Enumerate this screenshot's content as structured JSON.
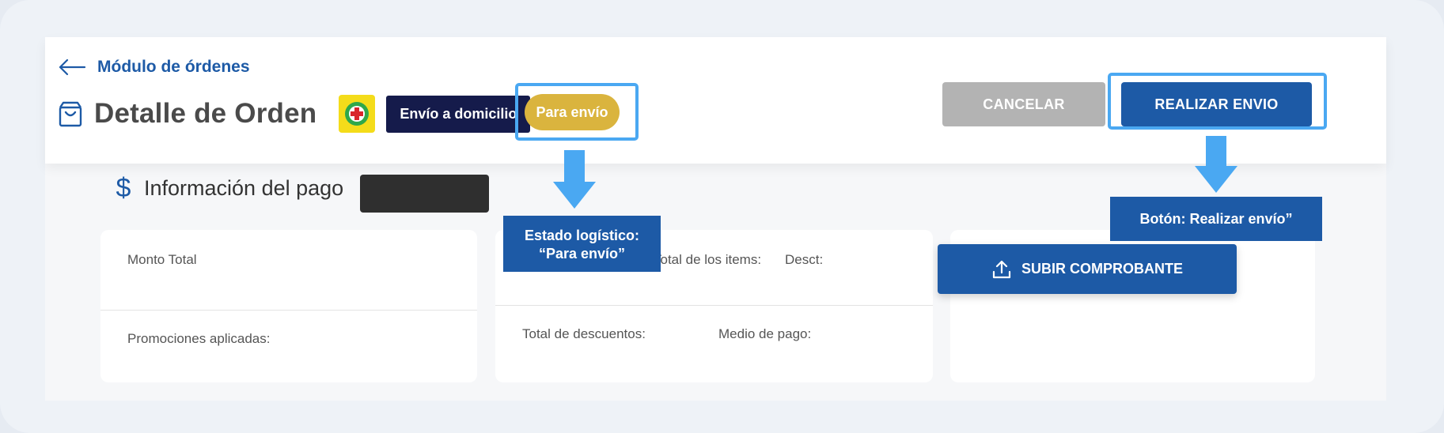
{
  "header": {
    "back_label": "Módulo de órdenes",
    "title": "Detalle de Orden",
    "shipping_chip": "Envío a domicilio",
    "status_chip": "Para envío",
    "cancel_button": "CANCELAR",
    "send_button": "REALIZAR ENVIO"
  },
  "payment": {
    "section_title": "Información del pago",
    "card1": {
      "total_label": "Monto Total",
      "promos_label": "Promociones aplicadas:"
    },
    "card2": {
      "items_total_label": "Total de los items:",
      "discount_label": "Desct:",
      "discounts_total_label": "Total de descuentos:",
      "payment_method_label": "Medio de pago:"
    },
    "upload_button": "SUBIR COMPROBANTE"
  },
  "annotations": {
    "status_callout_line1": "Estado logístico:",
    "status_callout_line2": "“Para envío”",
    "send_callout": "Botón: Realizar envío”"
  },
  "colors": {
    "primary": "#1d5aa6",
    "highlight": "#4aa8f2",
    "status_chip": "#dab43e",
    "shipping_chip": "#151b4b",
    "cancel": "#b3b3b3"
  },
  "icons": [
    "back-arrow-icon",
    "shopping-bag-icon",
    "pharmacy-logo-icon",
    "dollar-icon",
    "upload-icon",
    "arrow-down-icon"
  ]
}
